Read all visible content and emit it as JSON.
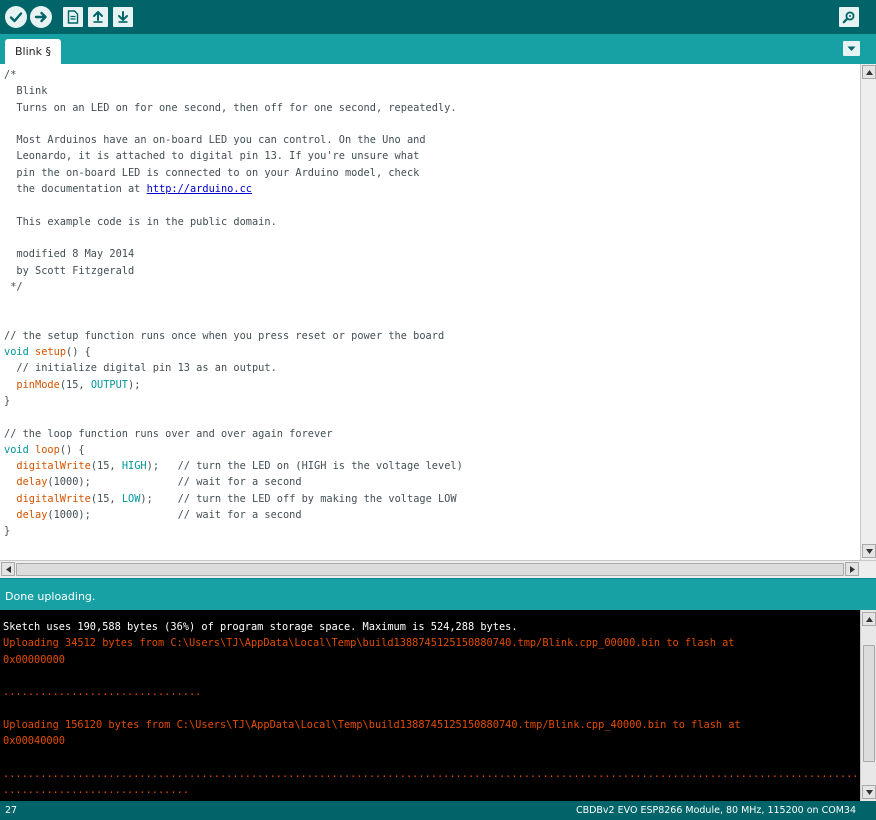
{
  "toolbar": {
    "verify": "verify-icon",
    "upload": "upload-icon",
    "new": "new-file-icon",
    "open": "open-icon",
    "save": "save-icon",
    "serial_monitor": "serial-monitor-icon"
  },
  "tabs": {
    "active": "Blink §"
  },
  "editor": {
    "lines": [
      [
        {
          "t": "/*",
          "c": "cm"
        }
      ],
      [
        {
          "t": "  Blink",
          "c": "cm"
        }
      ],
      [
        {
          "t": "  Turns on an LED on for one second, then off for one second, repeatedly.",
          "c": "cm"
        }
      ],
      [
        {
          "t": "",
          "c": "cm"
        }
      ],
      [
        {
          "t": "  Most Arduinos have an on-board LED you can control. On the Uno and",
          "c": "cm"
        }
      ],
      [
        {
          "t": "  Leonardo, it is attached to digital pin 13. If you're unsure what",
          "c": "cm"
        }
      ],
      [
        {
          "t": "  pin the on-board LED is connected to on your Arduino model, check",
          "c": "cm"
        }
      ],
      [
        {
          "t": "  the documentation at ",
          "c": "cm"
        },
        {
          "t": "http://arduino.cc",
          "c": "lnk"
        }
      ],
      [
        {
          "t": "",
          "c": "cm"
        }
      ],
      [
        {
          "t": "  This example code is in the public domain.",
          "c": "cm"
        }
      ],
      [
        {
          "t": "",
          "c": "cm"
        }
      ],
      [
        {
          "t": "  modified 8 May 2014",
          "c": "cm"
        }
      ],
      [
        {
          "t": "  by Scott Fitzgerald",
          "c": "cm"
        }
      ],
      [
        {
          "t": " */",
          "c": "cm"
        }
      ],
      [
        {
          "t": "",
          "c": "cm"
        }
      ],
      [
        {
          "t": "",
          "c": "cm"
        }
      ],
      [
        {
          "t": "// the setup function runs once when you press reset or power the board",
          "c": "cm"
        }
      ],
      [
        {
          "t": "void",
          "c": "kw"
        },
        {
          "t": " ",
          "c": "cm"
        },
        {
          "t": "setup",
          "c": "fn"
        },
        {
          "t": "() {",
          "c": "cm"
        }
      ],
      [
        {
          "t": "  // initialize digital pin 13 as an output.",
          "c": "cm"
        }
      ],
      [
        {
          "t": "  ",
          "c": "cm"
        },
        {
          "t": "pinMode",
          "c": "fn"
        },
        {
          "t": "(15, ",
          "c": "cm"
        },
        {
          "t": "OUTPUT",
          "c": "ct"
        },
        {
          "t": ");",
          "c": "cm"
        }
      ],
      [
        {
          "t": "}",
          "c": "cm"
        }
      ],
      [
        {
          "t": "",
          "c": "cm"
        }
      ],
      [
        {
          "t": "// the loop function runs over and over again forever",
          "c": "cm"
        }
      ],
      [
        {
          "t": "void",
          "c": "kw"
        },
        {
          "t": " ",
          "c": "cm"
        },
        {
          "t": "loop",
          "c": "fn"
        },
        {
          "t": "() {",
          "c": "cm"
        }
      ],
      [
        {
          "t": "  ",
          "c": "cm"
        },
        {
          "t": "digitalWrite",
          "c": "fn"
        },
        {
          "t": "(15, ",
          "c": "cm"
        },
        {
          "t": "HIGH",
          "c": "ct"
        },
        {
          "t": ");   // turn the LED on (HIGH is the voltage level)",
          "c": "cm"
        }
      ],
      [
        {
          "t": "  ",
          "c": "cm"
        },
        {
          "t": "delay",
          "c": "fn"
        },
        {
          "t": "(1000);              // wait for a second",
          "c": "cm"
        }
      ],
      [
        {
          "t": "  ",
          "c": "cm"
        },
        {
          "t": "digitalWrite",
          "c": "fn"
        },
        {
          "t": "(15, ",
          "c": "cm"
        },
        {
          "t": "LOW",
          "c": "ct"
        },
        {
          "t": ");    // turn the LED off by making the voltage LOW",
          "c": "cm"
        }
      ],
      [
        {
          "t": "  ",
          "c": "cm"
        },
        {
          "t": "delay",
          "c": "fn"
        },
        {
          "t": "(1000);              // wait for a second",
          "c": "cm"
        }
      ],
      [
        {
          "t": "}",
          "c": "cm"
        }
      ]
    ]
  },
  "status": {
    "message": "Done uploading."
  },
  "console": {
    "lines": [
      {
        "t": "Sketch uses 190,588 bytes (36%) of program storage space. Maximum is 524,288 bytes.",
        "c": "c-white"
      },
      {
        "t": "Uploading 34512 bytes from C:\\Users\\TJ\\AppData\\Local\\Temp\\build1388745125150880740.tmp/Blink.cpp_00000.bin to flash at",
        "c": "c-orange"
      },
      {
        "t": "0x00000000",
        "c": "c-orange"
      },
      {
        "t": "",
        "c": "c-orange"
      },
      {
        "t": "................................",
        "c": "c-orange"
      },
      {
        "t": "",
        "c": "c-orange"
      },
      {
        "t": "Uploading 156120 bytes from C:\\Users\\TJ\\AppData\\Local\\Temp\\build1388745125150880740.tmp/Blink.cpp_40000.bin to flash at",
        "c": "c-orange"
      },
      {
        "t": "0x00040000",
        "c": "c-orange"
      },
      {
        "t": "",
        "c": "c-orange"
      },
      {
        "t": "............................................................................................................................................",
        "c": "c-orange"
      },
      {
        "t": "..............................",
        "c": "c-orange"
      }
    ]
  },
  "footer": {
    "line_number": "27",
    "board": "CBDBv2 EVO ESP8266 Module, 80 MHz, 115200 on COM34"
  },
  "colors": {
    "toolbar": "#006468",
    "tabbar": "#17a1a5",
    "comment": "#434f54",
    "keyword": "#00979c",
    "function": "#d35400",
    "console_error": "#e34c00"
  }
}
